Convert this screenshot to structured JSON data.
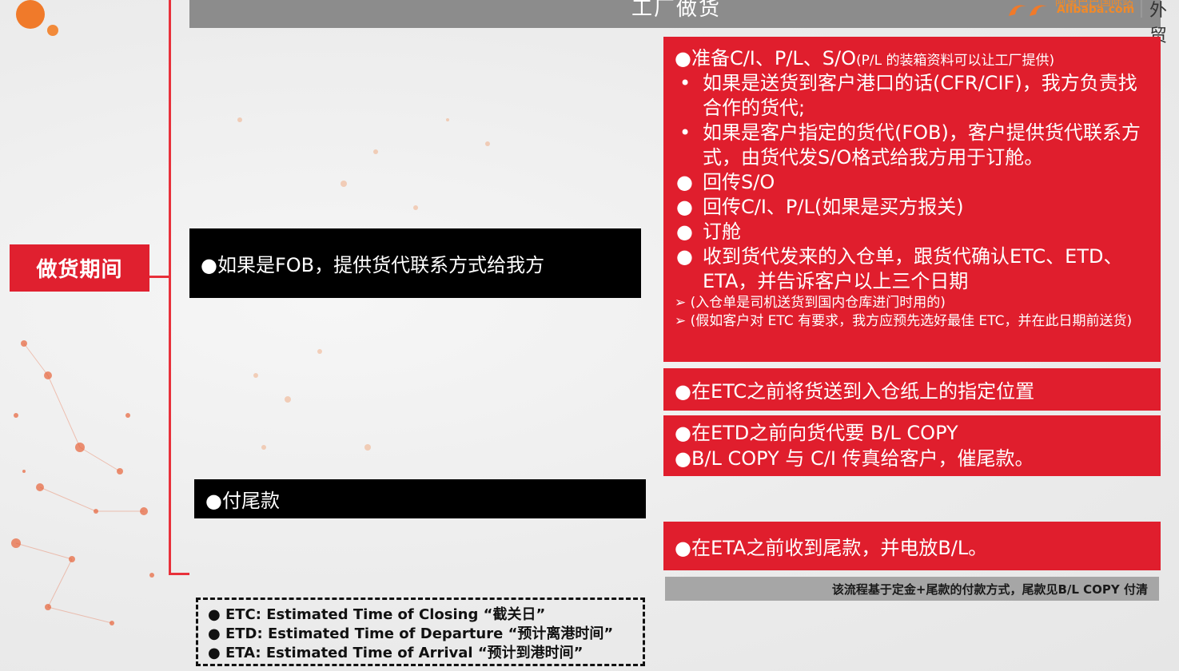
{
  "header": {
    "title": "工厂做货"
  },
  "logo": {
    "cn": "阿里巴巴国际站",
    "en": "Alibaba.com",
    "side": "外贸"
  },
  "period_label": "做货期间",
  "black_boxes": [
    "●如果是FOB，提供货代联系方式给我方",
    "●付尾款"
  ],
  "main_box": {
    "title": "●准备C/I、P/L、S/O",
    "title_note": "(P/L 的装箱资料可以让工厂提供)",
    "items": [
      {
        "bullet": "•",
        "text": "如果是送货到客户港口的话(CFR/CIF)，我方负责找合作的货代;"
      },
      {
        "bullet": "•",
        "text": "如果是客户指定的货代(FOB)，客户提供货代联系方式，由货代发S/O格式给我方用于订舱。"
      },
      {
        "bullet": "●",
        "text": "回传S/O"
      },
      {
        "bullet": "●",
        "text": "回传C/I、P/L(如果是买方报关)"
      },
      {
        "bullet": "●",
        "text": "订舱"
      },
      {
        "bullet": "●",
        "text": "收到货代发来的入仓单，跟货代确认ETC、ETD、ETA，并告诉客户以上三个日期"
      }
    ],
    "subnotes": [
      "➢ (入仓单是司机送货到国内仓库进门时用的)",
      "➢ (假如客户对 ETC 有要求，我方应预先选好最佳 ETC，并在此日期前送货)"
    ]
  },
  "red_box_2": "●在ETC之前将货送到入仓纸上的指定位置",
  "red_box_3": [
    "●在ETD之前向货代要 B/L COPY",
    "●B/L COPY 与 C/I 传真给客户，催尾款。"
  ],
  "red_box_4": "●在ETA之前收到尾款，并电放B/L。",
  "note": "该流程基于定金+尾款的付款方式，尾款见B/L COPY 付清",
  "definitions": [
    "●  ETC: Estimated Time of Closing “截关日”",
    "●  ETD: Estimated Time of Departure “预计离港时间”",
    "●  ETA: Estimated Time of Arrival “预计到港时间”"
  ],
  "colors": {
    "accent_red": "#e01e2d",
    "header_gray": "#8c8c8c",
    "note_gray": "#a6a6a6"
  }
}
